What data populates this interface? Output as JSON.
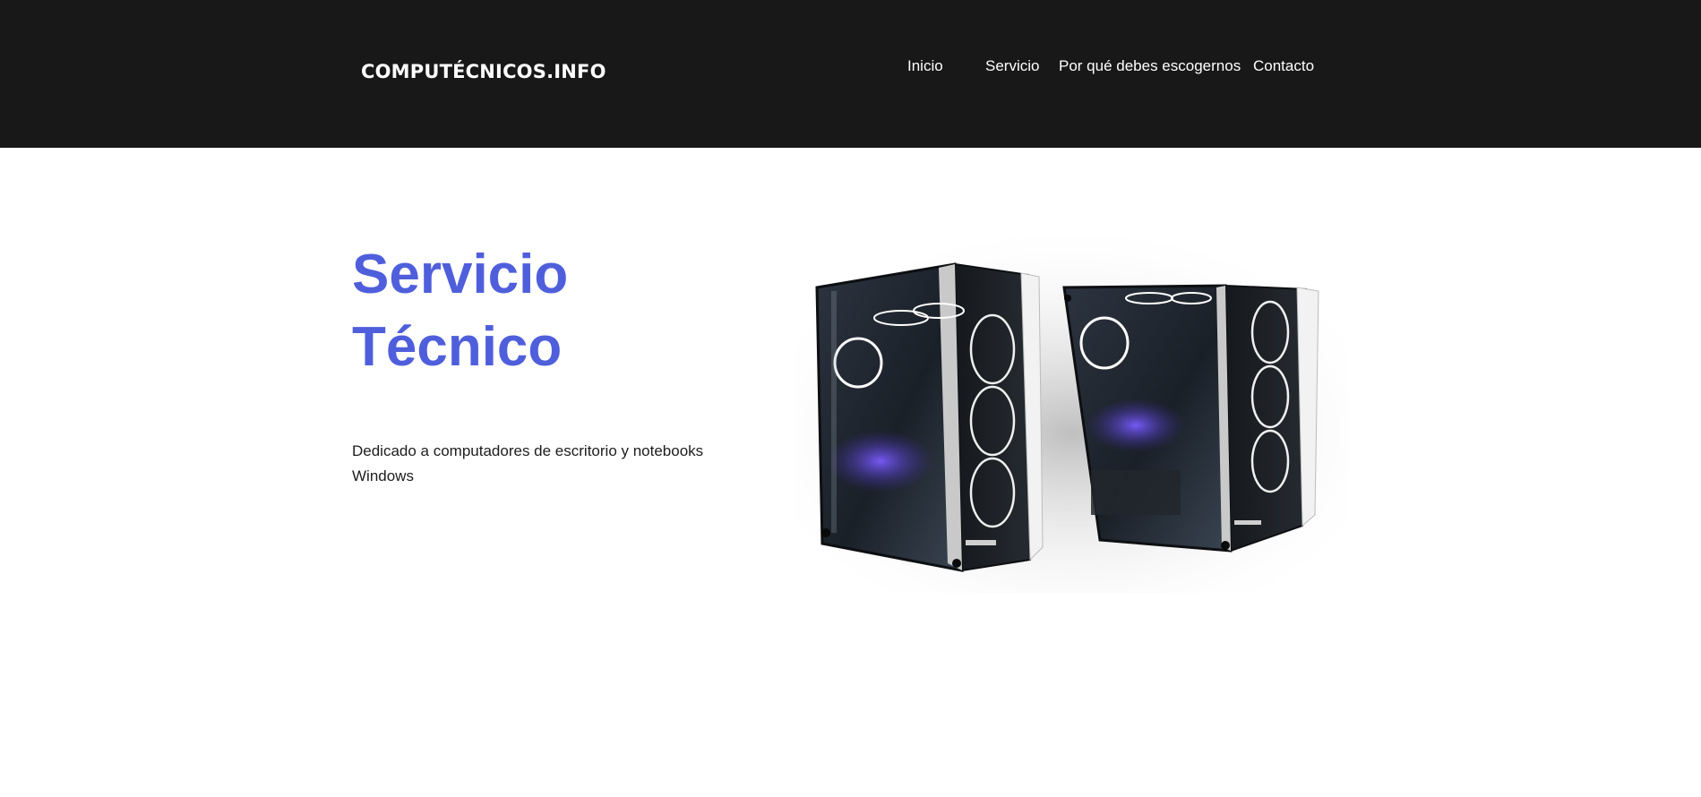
{
  "header": {
    "logo": "COMPUTÉCNICOS.INFO",
    "nav": [
      {
        "label": "Inicio"
      },
      {
        "label": "Servicio"
      },
      {
        "label": "Por qué debes escogernos"
      },
      {
        "label": "Contacto"
      }
    ]
  },
  "hero": {
    "title_line1": "Servicio",
    "title_line2": "Técnico",
    "description": "Dedicado a computadores de escritorio y notebooks Windows"
  },
  "colors": {
    "header_bg": "#181818",
    "accent": "#4f5fdb",
    "text": "#1d1d1d"
  }
}
